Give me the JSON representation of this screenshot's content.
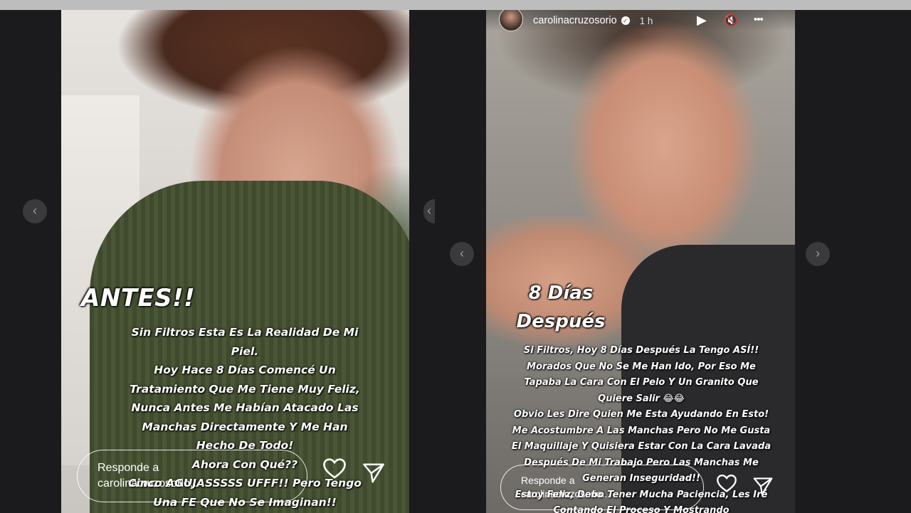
{
  "left_story": {
    "title": "ANTES!!",
    "caption_lines": [
      "Sin Filtros Esta Es La Realidad De Mi",
      "Piel.",
      "Hoy Hace 8 Días Comencé Un",
      "Tratamiento Que Me Tiene Muy Feliz,",
      "Nunca Antes Me Habían Atacado Las",
      "Manchas Directamente Y Me Han",
      "Hecho De Todo!",
      "Ahora Con Qué??",
      "Cinco AGUJASSSSS UFFF!! Pero Tengo",
      "Una FE Que No Se Imaginan!!"
    ],
    "reply_placeholder_line1": "Responde a",
    "reply_placeholder_line2": "carolinacruzosorio..."
  },
  "right_story": {
    "username": "carolinacruzosorio",
    "time": "1 h",
    "title_line1": "8 Días",
    "title_line2": "Después",
    "caption_lines": [
      "Si Filtros, Hoy 8 Días Después La Tengo ASÍ!!",
      "Morados Que No Se Me Han Ido, Por Eso Me",
      "Tapaba La Cara Con El Pelo Y Un Granito Que",
      "Quiere Salir 😂😂",
      "Obvio Les Dire Quien Me Esta Ayudando En Esto!",
      "Me Acostumbre A Las Manchas Pero No Me Gusta",
      "El Maquillaje Y Quisiera Estar Con La Cara Lavada",
      "Después De Mi Trabajo Pero Las Manchas Me",
      "Generan Inseguridad!!",
      "Estoy Feliz, Debo Tener Mucha Paciencia, Les Iré",
      "Contando El Proceso Y Mostrando"
    ],
    "reply_placeholder_line1": "Responde a",
    "reply_placeholder_line2": "carolinacruzosorio..."
  },
  "icons": {
    "heart": "heart-icon",
    "send": "send-icon",
    "play": "play-icon",
    "mute": "mute-icon",
    "more": "more-icon",
    "prev": "chevron-left-icon",
    "next": "chevron-right-icon"
  },
  "glyphs": {
    "play": "▶",
    "mute": "🔇",
    "more": "•••",
    "prev": "‹",
    "next": "›",
    "verified": "✓"
  }
}
